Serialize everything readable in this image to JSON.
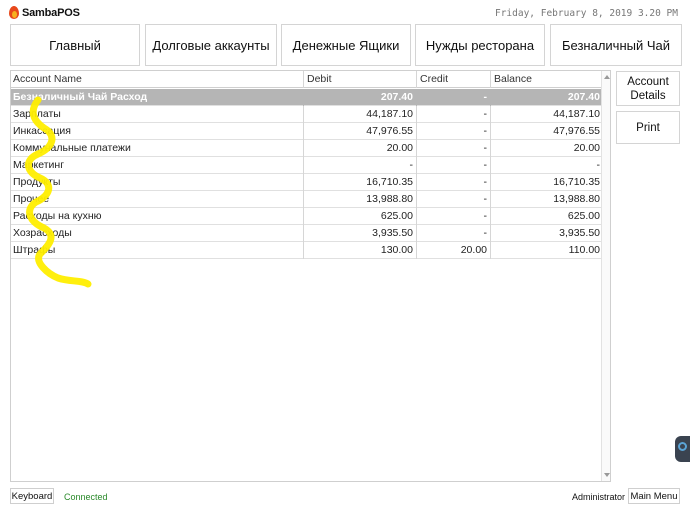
{
  "app": {
    "name": "SambaPOS"
  },
  "header": {
    "datetime": "Friday, February 8, 2019 3.20 PM"
  },
  "topbar": {
    "buttons": [
      "Главный",
      "Долговые аккаунты",
      "Денежные Ящики",
      "Нужды ресторана",
      "Безналичный Чай"
    ]
  },
  "table": {
    "columns": [
      "Account Name",
      "Debit",
      "Credit",
      "Balance"
    ],
    "rows": [
      {
        "name": "Безналичный Чай Расход",
        "debit": "207.40",
        "credit": "-",
        "balance": "207.40"
      },
      {
        "name": "Зарплаты",
        "debit": "44,187.10",
        "credit": "-",
        "balance": "44,187.10"
      },
      {
        "name": "Инкассация",
        "debit": "47,976.55",
        "credit": "-",
        "balance": "47,976.55"
      },
      {
        "name": "Коммунальные платежи",
        "debit": "20.00",
        "credit": "-",
        "balance": "20.00"
      },
      {
        "name": "Маркетинг",
        "debit": "-",
        "credit": "-",
        "balance": "-"
      },
      {
        "name": "Продукты",
        "debit": "16,710.35",
        "credit": "-",
        "balance": "16,710.35"
      },
      {
        "name": "Прочее",
        "debit": "13,988.80",
        "credit": "-",
        "balance": "13,988.80"
      },
      {
        "name": "Расходы на кухню",
        "debit": "625.00",
        "credit": "-",
        "balance": "625.00"
      },
      {
        "name": "Хозрасходы",
        "debit": "3,935.50",
        "credit": "-",
        "balance": "3,935.50"
      },
      {
        "name": "Штрафы",
        "debit": "130.00",
        "credit": "20.00",
        "balance": "110.00"
      }
    ]
  },
  "side": {
    "account_details": "Account Details",
    "print": "Print"
  },
  "footer": {
    "keyboard": "Keyboard",
    "status": "Connected",
    "user": "Administrator",
    "main_menu": "Main Menu"
  },
  "colors": {
    "selected_row": "#b5b5b5",
    "status_connected": "#2a8a2a",
    "logo_flame": "#e8481b",
    "annotation": "#ffee00"
  }
}
